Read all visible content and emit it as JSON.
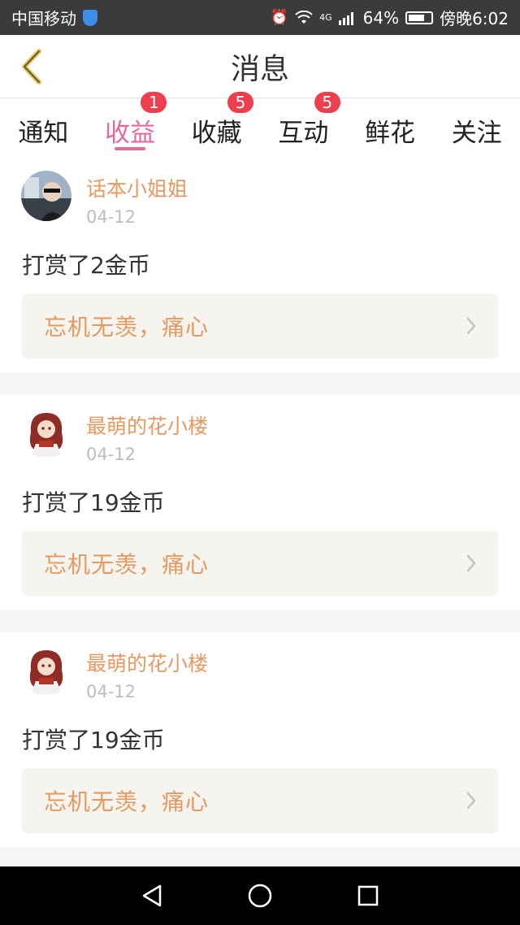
{
  "status_bar": {
    "carrier": "中国移动",
    "network": "4G",
    "battery": "64%",
    "time": "傍晚6:02"
  },
  "header": {
    "title": "消息",
    "back_icon": "chevron-left-icon"
  },
  "tabs": [
    {
      "label": "通知",
      "active": false,
      "badge": ""
    },
    {
      "label": "收益",
      "active": true,
      "badge": "1"
    },
    {
      "label": "收藏",
      "active": false,
      "badge": "5"
    },
    {
      "label": "互动",
      "active": false,
      "badge": "5"
    },
    {
      "label": "鲜花",
      "active": false,
      "badge": ""
    },
    {
      "label": "关注",
      "active": false,
      "badge": ""
    }
  ],
  "feed": [
    {
      "sender": "话本小姐姐",
      "date": "04-12",
      "action": "打赏了2金币",
      "reference": "忘机无羡，痛心"
    },
    {
      "sender": "最萌的花小楼",
      "date": "04-12",
      "action": "打赏了19金币",
      "reference": "忘机无羡，痛心"
    },
    {
      "sender": "最萌的花小楼",
      "date": "04-12",
      "action": "打赏了19金币",
      "reference": "忘机无羡，痛心"
    }
  ],
  "colors": {
    "accent_pink": "#e46a98",
    "name_orange": "#e69a63",
    "badge_red": "#ef3f4e",
    "back_arrow": "#e2c76b"
  }
}
